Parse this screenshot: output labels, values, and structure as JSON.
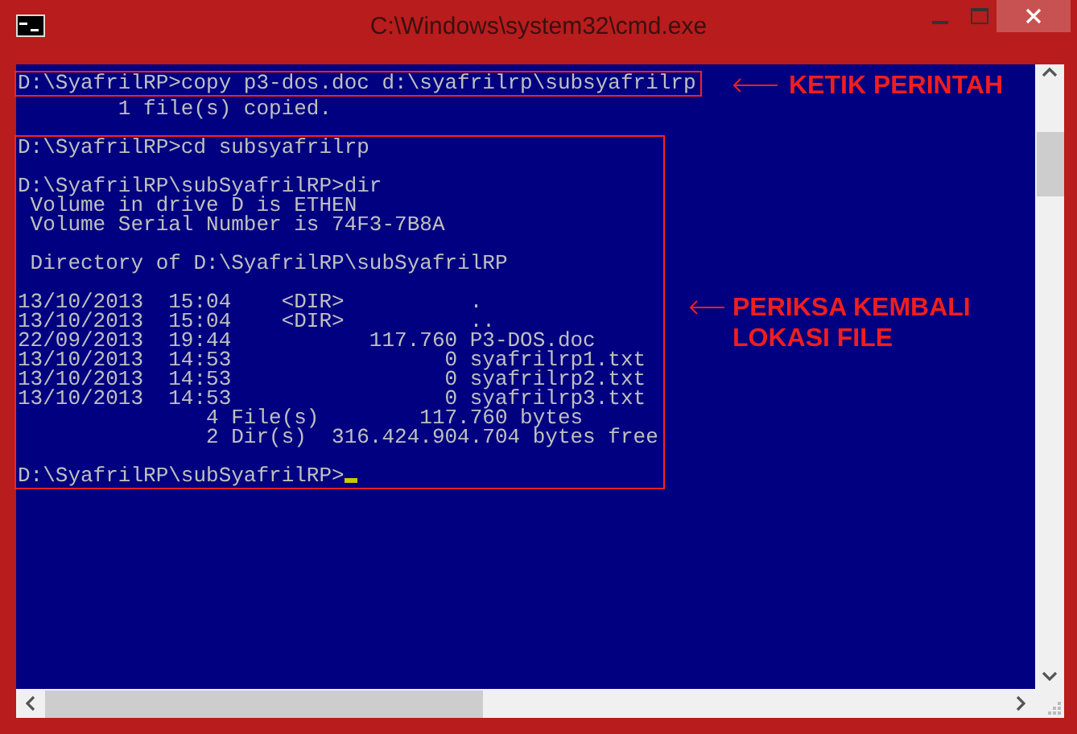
{
  "window": {
    "title": "C:\\Windows\\system32\\cmd.exe"
  },
  "console": {
    "sections": [
      {
        "framed": true,
        "blocks": [
          [
            "D:\\SyafrilRP>copy p3-dos.doc d:\\syafrilrp\\subsyafrilrp"
          ]
        ]
      },
      {
        "framed": false,
        "blocks": [
          [
            "        1 file(s) copied."
          ]
        ]
      },
      {
        "framed": true,
        "blocks": [
          [
            "D:\\SyafrilRP>cd subsyafrilrp"
          ],
          [
            "D:\\SyafrilRP\\subSyafrilRP>dir",
            " Volume in drive D is ETHEN",
            " Volume Serial Number is 74F3-7B8A"
          ],
          [
            " Directory of D:\\SyafrilRP\\subSyafrilRP"
          ],
          [
            "13/10/2013  15:04    <DIR>          .",
            "13/10/2013  15:04    <DIR>          ..",
            "22/09/2013  19:44           117.760 P3-DOS.doc",
            "13/10/2013  14:53                 0 syafrilrp1.txt",
            "13/10/2013  14:53                 0 syafrilrp2.txt",
            "13/10/2013  14:53                 0 syafrilrp3.txt",
            "               4 File(s)        117.760 bytes",
            "               2 Dir(s)  316.424.904.704 bytes free"
          ],
          [
            "D:\\SyafrilRP\\subSyafrilRP>"
          ]
        ]
      }
    ],
    "cursor_visible": true
  },
  "annotations": [
    {
      "text": "KETIK PERINTAH"
    },
    {
      "text": "PERIKSA KEMBALI LOKASI FILE"
    }
  ]
}
